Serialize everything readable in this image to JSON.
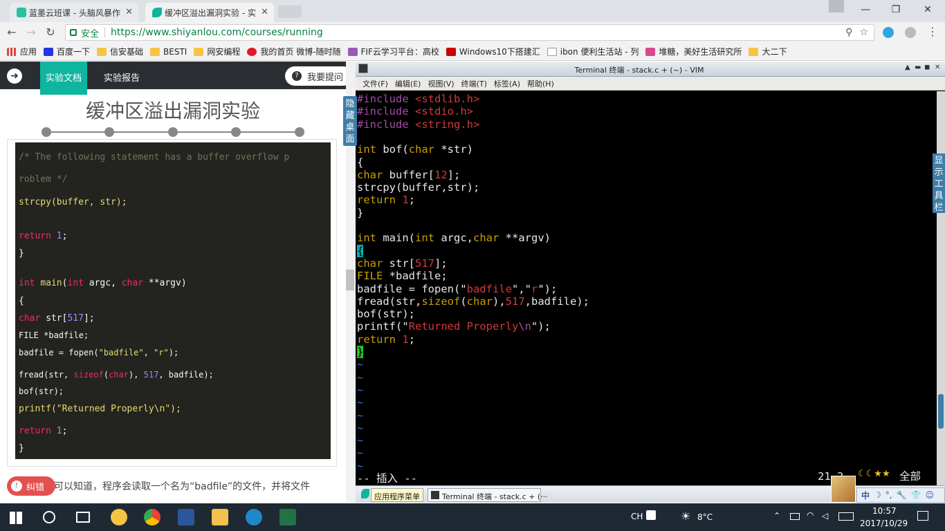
{
  "browser": {
    "tabs": [
      {
        "label": "蓝墨云班课 - 头脑风暴作",
        "active": false
      },
      {
        "label": "缓冲区溢出漏洞实验 - 实",
        "active": true
      }
    ],
    "close_glyph": "✕",
    "address": {
      "secure_label": "安全",
      "url": "https://www.shiyanlou.com/courses/running"
    },
    "bookmarks": [
      {
        "label": "应用",
        "icon": "apps-grid-icon"
      },
      {
        "label": "百度一下",
        "icon": "baidu-paw-icon"
      },
      {
        "label": "信安基础",
        "icon": "folder-icon"
      },
      {
        "label": "BESTI",
        "icon": "folder-icon"
      },
      {
        "label": "网安编程",
        "icon": "folder-icon"
      },
      {
        "label": "我的首页 微博-随时随",
        "icon": "weibo-icon"
      },
      {
        "label": "FIF云学习平台：高校",
        "icon": "fif-icon"
      },
      {
        "label": "Windows10下搭建汇",
        "icon": "csdn-icon"
      },
      {
        "label": "ibon 便利生活站 - 列",
        "icon": "page-icon"
      },
      {
        "label": "堆糖，美好生活研究所",
        "icon": "duitang-icon"
      },
      {
        "label": "大二下",
        "icon": "folder-icon"
      }
    ]
  },
  "lab": {
    "back_glyph": "➜",
    "tab_doc": "实验文档",
    "tab_report": "实验报告",
    "ask_label": "我要提问",
    "ask_glyph": "?",
    "title": "缓冲区溢出漏洞实验",
    "code_lines": [
      "/* The following statement has a buffer overflow p",
      "roblem */",
      "strcpy(buffer, str);",
      "",
      "return 1;",
      "}",
      "",
      "int main(int argc, char **argv)",
      "{",
      "char str[517];",
      "FILE *badfile;",
      "badfile = fopen(\"badfile\", \"r\");",
      "fread(str, sizeof(char), 517, badfile);",
      "bof(str);",
      "printf(\"Returned Properly\\n\");",
      "return 1;",
      "}"
    ],
    "error_button": "纠错",
    "error_glyph": "!",
    "bottom_text": "可以知道，程序会读取一个名为“badfile”的文件，并将文件",
    "hide_desktop": "隐藏桌面",
    "show_toolbar": "显示工具栏"
  },
  "vm": {
    "window_title": "Terminal 终端 - stack.c + (~) - VIM",
    "menu": [
      "文件(F)",
      "编辑(E)",
      "视图(V)",
      "终端(T)",
      "标签(A)",
      "帮助(H)"
    ],
    "vim_lines": [
      "#include <stdlib.h>",
      "#include <stdio.h>",
      "#include <string.h>",
      "",
      "int bof(char *str)",
      "{",
      "char buffer[12];",
      "strcpy(buffer,str);",
      "return 1;",
      "}",
      "",
      "int main(int argc,char **argv)",
      "{",
      "char str[517];",
      "FILE *badfile;",
      "badfile = fopen(\"badfile\",\"r\");",
      "fread(str,sizeof(char),517,badfile);",
      "bof(str);",
      "printf(\"Returned Properly\\n\");",
      "return 1;",
      "}"
    ],
    "tilde": "~",
    "mode": "-- 插入 --",
    "position": "21,2",
    "scroll_pos": "全部",
    "taskbar": [
      {
        "label": "应用程序菜单"
      },
      {
        "label": "Terminal 终端 - stack.c + (···"
      }
    ],
    "ime": {
      "mode": "中",
      "glyphs": [
        "☽",
        "°,",
        "🔧",
        "👕",
        "☺"
      ]
    },
    "stars": "☾☾★★"
  },
  "windows": {
    "input_lang": "CH",
    "weather": "8°C",
    "time": "10:57",
    "date": "2017/10/29"
  }
}
